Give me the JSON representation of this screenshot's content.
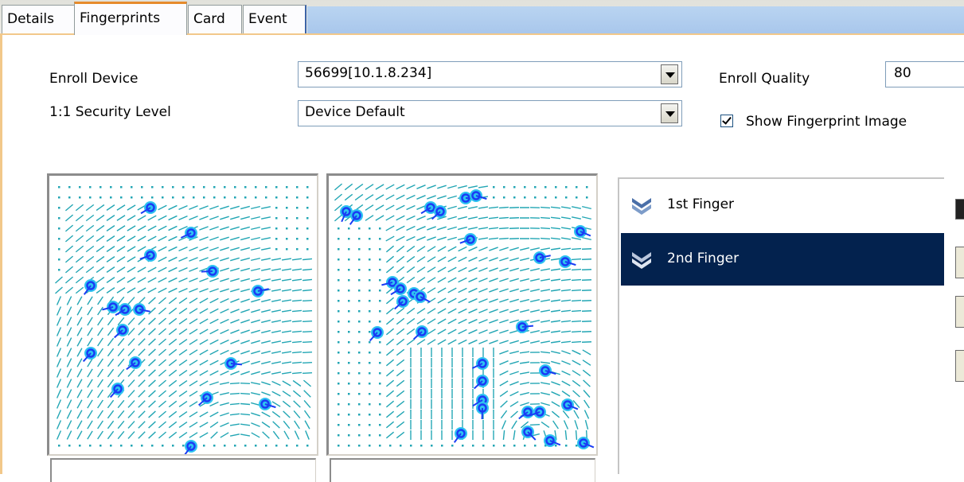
{
  "tabs": [
    "Details",
    "Fingerprints",
    "Card",
    "Event"
  ],
  "form": {
    "enroll_device_label": "Enroll Device",
    "enroll_device_value": "56699[10.1.8.234]",
    "security_level_label": "1:1 Security Level",
    "security_level_value": "Device Default",
    "enroll_quality_label": "Enroll Quality",
    "enroll_quality_value": "80",
    "show_image_label": "Show Fingerprint Image",
    "show_image_checked": true
  },
  "fingers": [
    {
      "label": "1st Finger",
      "selected": false
    },
    {
      "label": "2nd Finger",
      "selected": true
    }
  ],
  "colors": {
    "accent_tab": "#e68b2c",
    "selection": "#03224e",
    "ridge": "#22a6b4",
    "minutia": "#1a3cf5"
  }
}
